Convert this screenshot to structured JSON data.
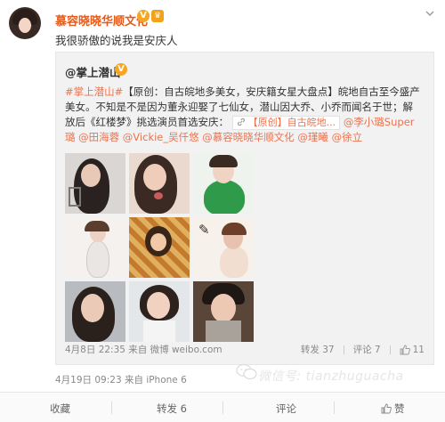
{
  "post": {
    "author": "慕容晓晓华顺文化",
    "verified_badge": "V",
    "text": "我很骄傲的说我是安庆人",
    "meta": "4月19日 09:23 来自 iPhone 6"
  },
  "repost": {
    "author": "@掌上潜山",
    "verified_badge": "V",
    "hashtag": "#掌上潜山#",
    "body_1": "【原创：自古皖地多美女，安庆籍女星大盘点】皖地自古至今盛产美女。不知是不是因为董永迎娶了七仙女，潜山因大乔、小乔而闻名于世；解放后《红楼梦》挑选演员首选安庆：",
    "link_label": "【原创】自古皖地...",
    "mentions": "@李小璐Super璐 @田海蓉 @Vickie_吴仟悠 @慕容晓晓华顺文化 @瑾曦 @徐立",
    "meta": "4月8日 22:35 来自 微博 weibo.com",
    "actions": {
      "repost": "转发 37",
      "comment": "评论 7",
      "like": "11"
    }
  },
  "footer": {
    "favorite": "收藏",
    "repost": "转发 6",
    "comment": "评论",
    "like": "赞"
  },
  "watermark": "微信号: tianzhuguacha"
}
